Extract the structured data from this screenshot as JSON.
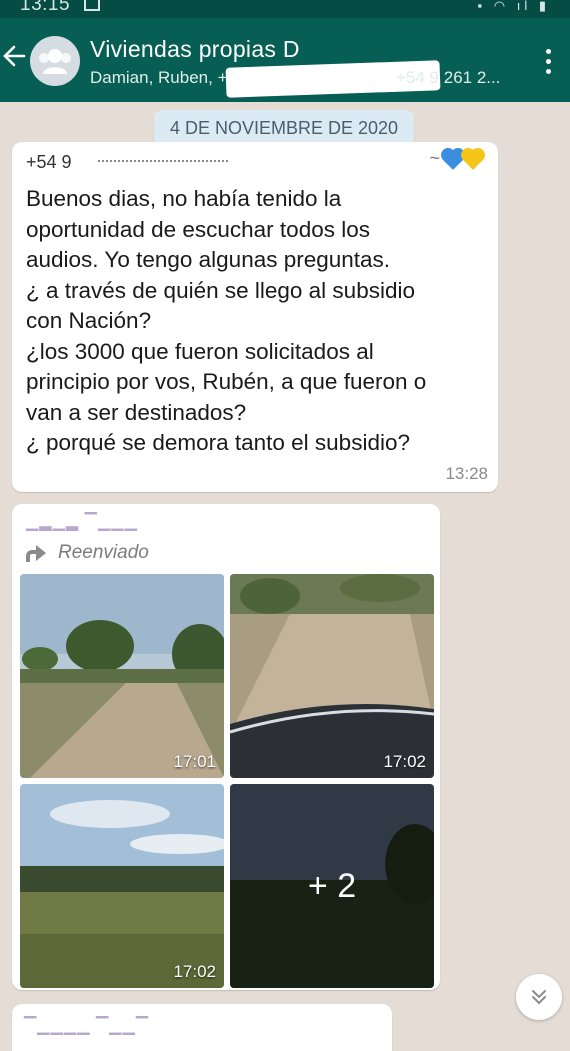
{
  "status_bar": {
    "time": "13:15"
  },
  "header": {
    "title": "Viviendas  propias  D",
    "subtitle_start": "Damian, Ruben, +",
    "subtitle_end": "+54 9 261 2..."
  },
  "date_chip": "4 DE NOVIEMBRE DE 2020",
  "messages": [
    {
      "sender": "+54 9",
      "text": "Buenos dias, no había tenido la\noportunidad de escuchar todos los\naudios. Yo tengo algunas preguntas.\n¿ a través de quién se llego al subsidio\ncon Nación?\n¿los 3000 que fueron solicitados al\nprincipio por vos, Rubén, a que fueron o\nvan a ser destinados?\n¿ porqué se demora tanto el subsidio?",
      "emoji_prefix": "~",
      "time": "13:28"
    },
    {
      "forwarded_label": "Reenviado",
      "photos": [
        {
          "time": "17:01"
        },
        {
          "time": "17:02"
        },
        {
          "time": "17:02"
        },
        {
          "more": "+ 2"
        }
      ]
    }
  ],
  "colors": {
    "header": "#075e54",
    "status_bar": "#054d44",
    "chat_bg": "#e5ddd5",
    "date_chip": "#dbeaf3"
  }
}
